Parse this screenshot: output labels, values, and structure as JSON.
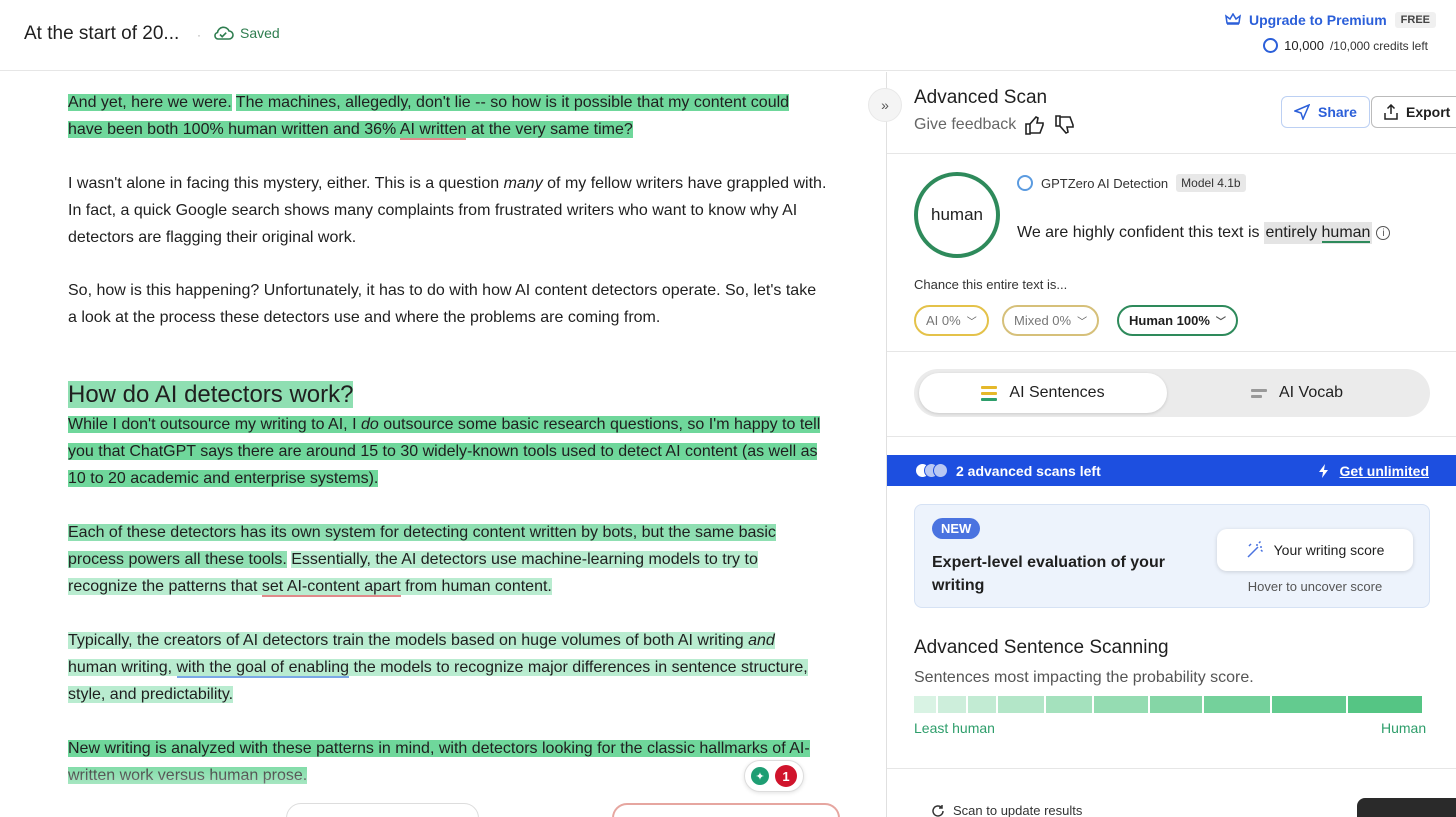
{
  "header": {
    "doc_title": "At the start of 20...",
    "saved_label": "Saved",
    "upgrade_label": "Upgrade to Premium",
    "plan_badge": "FREE",
    "credits_value": "10,000",
    "credits_total": "/10,000 credits left"
  },
  "editor": {
    "p1a": "And yet, here we were.",
    "p1b": "The machines, allegedly, don't lie -- so how is it possible that my content could have been both 100% human written and 36%",
    "p1c": "AI written",
    "p1d": "at the very same time?",
    "p2a": "I wasn't alone in facing this mystery, either. This is a question",
    "p2b": "many",
    "p2c": "of my fellow writers have grappled with. In fact, a quick Google search shows many complaints from frustrated writers who want to know why AI detectors are flagging their original work.",
    "p3": "So, how is this happening? Unfortunately, it has to do with how AI content detectors operate. So, let's take a look at the process these detectors use and where the problems are coming from.",
    "heading": "How do AI detectors work?",
    "p4a": "While I don't outsource my writing to AI, I",
    "p4b": "do",
    "p4c": "outsource some basic research questions, so I'm happy to tell you that ChatGPT says there are around 15 to 30 widely-known tools used to detect AI content (as well as 10 to 20 academic and enterprise systems).",
    "p5a": "Each of these detectors has its own system for detecting content written by bots, but the same basic process powers all these tools.",
    "p5b": "Essentially, the AI detectors use machine-learning models to try to recognize the patterns that",
    "p5c": "set AI-content apart",
    "p5d": "from human content.",
    "p6a": "Typically, the creators of AI detectors train the models based on huge volumes of both AI writing",
    "p6b": "and",
    "p6c": "human writing,",
    "p6d": "with the goal of enabling",
    "p6e": "the models to recognize major differences in sentence structure, style, and predictability.",
    "p7": "New writing is analyzed with these patterns in mind, with detectors looking for the classic hallmarks of AI-written work versus human prose.",
    "badge_count": "1"
  },
  "panel": {
    "title": "Advanced Scan",
    "feedback": "Give feedback",
    "share_label": "Share",
    "export_label": "Export",
    "result_label": "human",
    "detector_name": "GPTZero AI Detection",
    "model_badge": "Model 4.1b",
    "confident_prefix": "We are highly confident this text is",
    "confident_entirely": "entirely",
    "confident_human": "human",
    "chance_label": "Chance this entire text is...",
    "chip_ai": "AI 0%",
    "chip_mixed": "Mixed 0%",
    "chip_human": "Human 100%",
    "tab_sentences": "AI Sentences",
    "tab_vocab": "AI Vocab",
    "banner_text": "2 advanced scans left",
    "banner_link": "Get unlimited",
    "card_badge": "NEW",
    "card_text": "Expert-level evaluation of your writing",
    "score_button": "Your writing score",
    "hover_text": "Hover to uncover score",
    "adv_title": "Advanced Sentence Scanning",
    "adv_sub": "Sentences most impacting the probability score.",
    "least_label": "Least human",
    "most_label": "Human",
    "scan_update": "Scan to update results"
  },
  "colors": {
    "accent_blue": "#2b5fd9",
    "human_green": "#2e8a5b",
    "banner_blue": "#1d4fe0"
  }
}
